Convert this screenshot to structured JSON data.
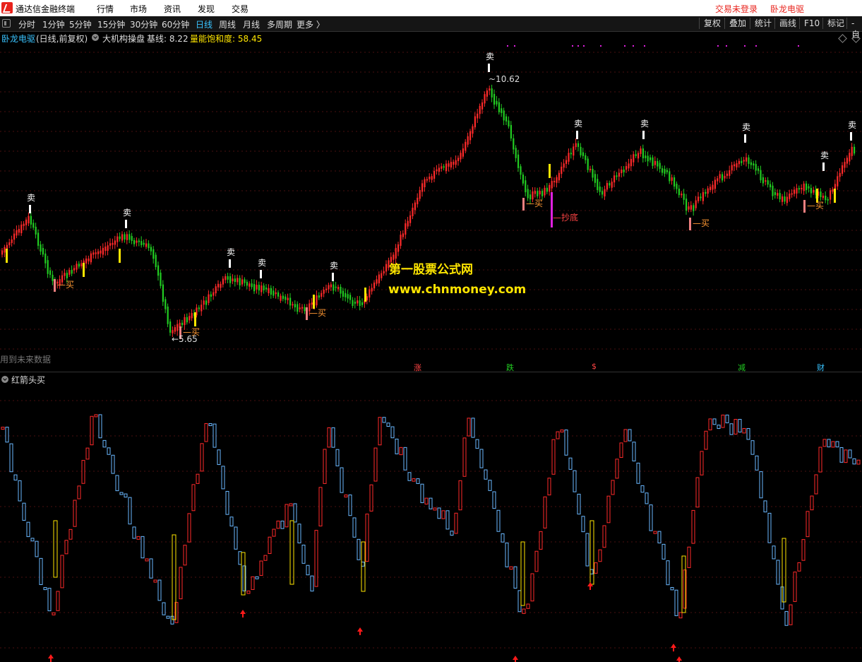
{
  "titlebar": {
    "app_name": "通达信金融终端",
    "menus": [
      "行情",
      "市场",
      "资讯",
      "发现",
      "交易"
    ],
    "login": "交易未登录",
    "brand": "卧龙电驱"
  },
  "toolbar": {
    "timeframes": [
      "分时",
      "1分钟",
      "5分钟",
      "15分钟",
      "30分钟",
      "60分钟",
      "日线",
      "周线",
      "月线",
      "多周期",
      "更多 〉"
    ],
    "active": "日线",
    "right_buttons": [
      "复权",
      "叠加",
      "统计",
      "画线",
      "F10",
      "标记",
      "-自"
    ]
  },
  "infobar": {
    "stock": "卧龙电驱",
    "mode": "(日线,前复权)",
    "indicator": "大机构操盘",
    "baseline": "基线: 8.22",
    "saturation": "量能饱和度: 58.45"
  },
  "main_chart": {
    "high_label": "10.62",
    "low_label": "5.65",
    "sell_label": "卖",
    "buy_label": "买",
    "bottom_label": "抄底",
    "warning": "用到未来数据",
    "news_tags": [
      "涨",
      "跌",
      "$",
      "减",
      "财"
    ]
  },
  "sub_chart": {
    "title": "红箭头买"
  },
  "watermark": {
    "line1": "第一股票公式网",
    "line2": "www.chnmoney.com"
  },
  "colors": {
    "up": "#ff2a2a",
    "down": "#22cc22",
    "accent": "#39c3ff",
    "yellow": "#ffe600",
    "magenta": "#e020e0"
  }
}
